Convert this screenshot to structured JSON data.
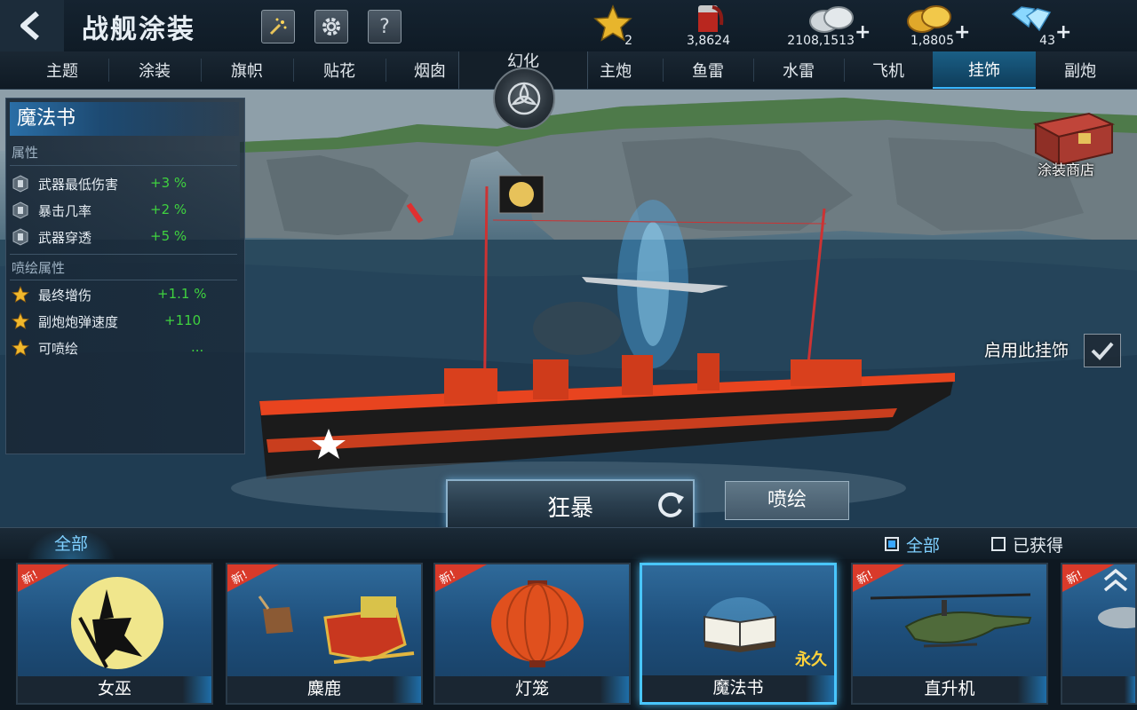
{
  "header": {
    "title": "战舰涂装",
    "icons": [
      "back-arrow-icon",
      "firework-icon",
      "gear-icon",
      "help-icon"
    ],
    "help_label": "?"
  },
  "resources": {
    "star": {
      "value": "2",
      "icon": "star-icon"
    },
    "paint": {
      "value": "3,8624",
      "icon": "paint-bucket-icon"
    },
    "silver": {
      "value": "2108,1513",
      "plus": "+",
      "icon": "silver-coins-icon"
    },
    "gold": {
      "value": "1,8805",
      "plus": "+",
      "icon": "gold-coins-icon"
    },
    "diamond": {
      "value": "43",
      "plus": "+",
      "icon": "diamond-icon"
    }
  },
  "tabs": {
    "left": [
      "主题",
      "涂装",
      "旗帜",
      "贴花",
      "烟囱"
    ],
    "center": "幻化",
    "right": [
      "主炮",
      "鱼雷",
      "水雷",
      "飞机",
      "挂饰",
      "副炮"
    ],
    "active": "挂饰"
  },
  "info": {
    "title": "魔法书",
    "section1": "属性",
    "attrs": [
      {
        "name": "武器最低伤害",
        "value": "+3 %"
      },
      {
        "name": "暴击几率",
        "value": "+2 %"
      },
      {
        "name": "武器穿透",
        "value": "+5 %"
      }
    ],
    "section2": "喷绘属性",
    "spray_attrs": [
      {
        "name": "最终增伤",
        "value": "+1.1 %"
      },
      {
        "name": "副炮炮弹速度",
        "value": "+110"
      },
      {
        "name": "可喷绘",
        "value": "..."
      }
    ]
  },
  "shop": {
    "label": "涂装商店",
    "icon": "chest-icon"
  },
  "enable": {
    "label": "启用此挂饰",
    "checked": true
  },
  "actions": {
    "main": "狂暴",
    "spray": "喷绘"
  },
  "filters": {
    "tab_all": "全部",
    "opt_all": "全部",
    "opt_owned": "已获得",
    "opt_all_checked": true,
    "opt_owned_checked": false
  },
  "cards": [
    {
      "name": "女巫",
      "new": "新!",
      "icon": "witch-icon"
    },
    {
      "name": "麋鹿",
      "new": "新!",
      "icon": "sleigh-icon"
    },
    {
      "name": "灯笼",
      "new": "新!",
      "icon": "lantern-icon"
    },
    {
      "name": "魔法书",
      "new": "",
      "tag": "永久",
      "icon": "book-icon",
      "selected": true
    },
    {
      "name": "直升机",
      "new": "新!",
      "icon": "helicopter-icon"
    },
    {
      "name": "",
      "new": "新!",
      "icon": "item-icon"
    }
  ],
  "colors": {
    "accent": "#39b6ff",
    "positive": "#3fd23f",
    "permanent": "#ffd23a",
    "new_badge": "#d93a2a"
  }
}
